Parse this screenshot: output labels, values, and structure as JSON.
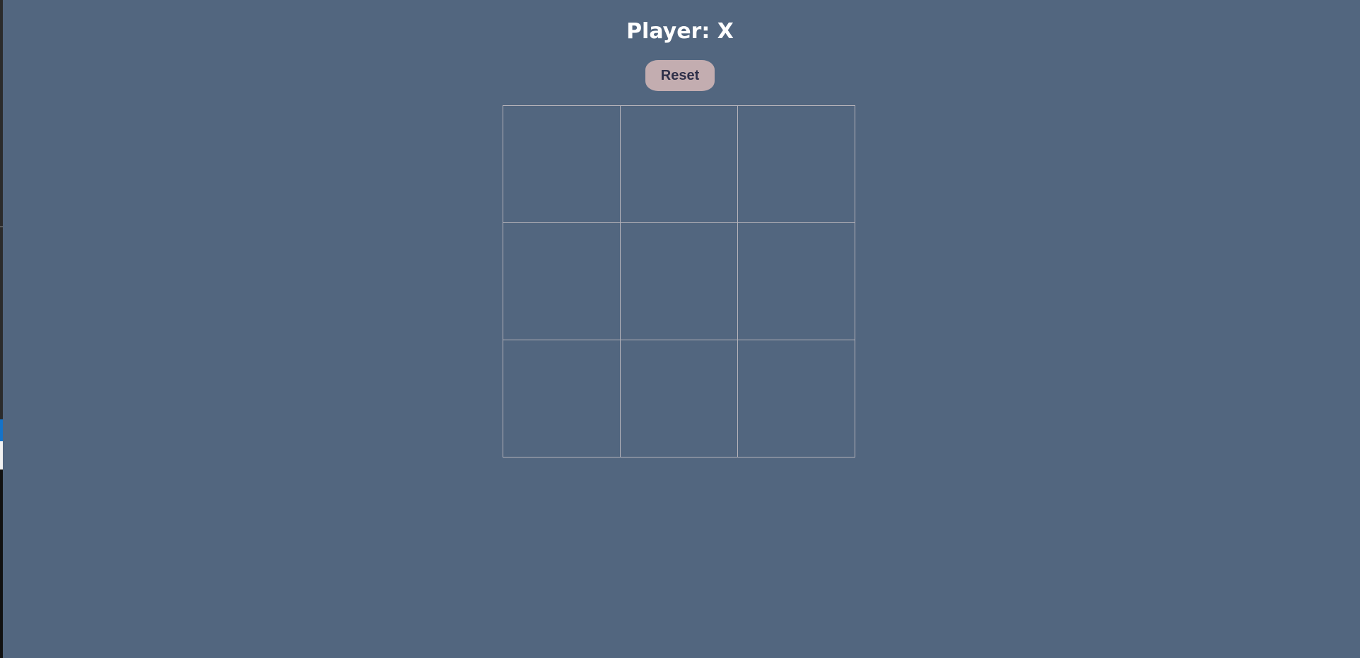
{
  "status": {
    "label": "Player: ",
    "current_player": "X"
  },
  "controls": {
    "reset_label": "Reset"
  },
  "board": {
    "cells": [
      "",
      "",
      "",
      "",
      "",
      "",
      "",
      "",
      ""
    ]
  },
  "colors": {
    "background": "#52667f",
    "button_bg": "#c3adb0",
    "button_text": "#2f3049",
    "grid_line": "#b4b2b9",
    "title_text": "#ffffff"
  }
}
